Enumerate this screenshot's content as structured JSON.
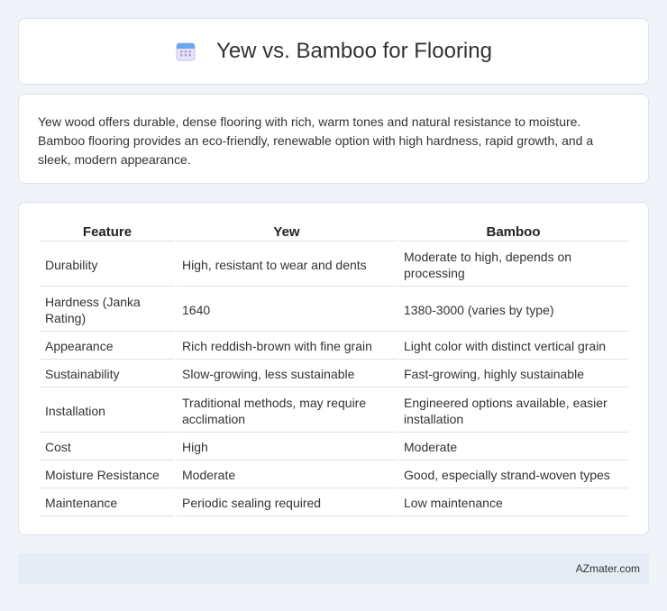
{
  "header": {
    "title": "Yew vs. Bamboo for Flooring",
    "icon": "calendar-icon"
  },
  "intro": {
    "text": "Yew wood offers durable, dense flooring with rich, warm tones and natural resistance to moisture. Bamboo flooring provides an eco-friendly, renewable option with high hardness, rapid growth, and a sleek, modern appearance."
  },
  "table": {
    "headers": [
      "Feature",
      "Yew",
      "Bamboo"
    ],
    "rows": [
      [
        "Durability",
        "High, resistant to wear and dents",
        "Moderate to high, depends on processing"
      ],
      [
        "Hardness (Janka Rating)",
        "1640",
        "1380-3000 (varies by type)"
      ],
      [
        "Appearance",
        "Rich reddish-brown with fine grain",
        "Light color with distinct vertical grain"
      ],
      [
        "Sustainability",
        "Slow-growing, less sustainable",
        "Fast-growing, highly sustainable"
      ],
      [
        "Installation",
        "Traditional methods, may require acclimation",
        "Engineered options available, easier installation"
      ],
      [
        "Cost",
        "High",
        "Moderate"
      ],
      [
        "Moisture Resistance",
        "Moderate",
        "Good, especially strand-woven types"
      ],
      [
        "Maintenance",
        "Periodic sealing required",
        "Low maintenance"
      ]
    ]
  },
  "footer": {
    "text": "AZmater.com"
  }
}
